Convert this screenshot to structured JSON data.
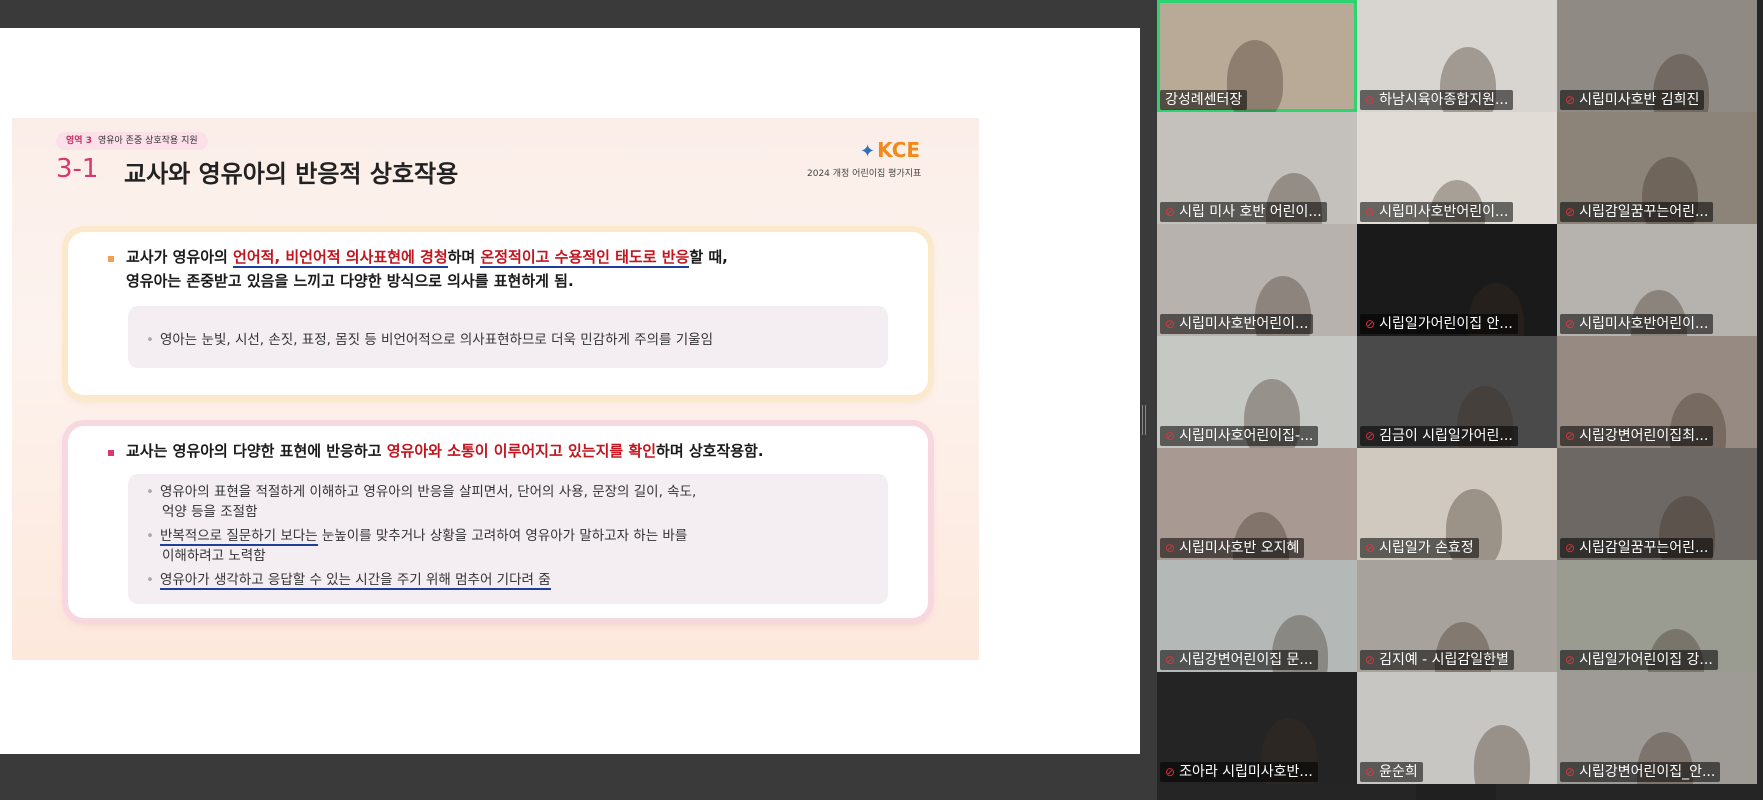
{
  "slide": {
    "tag_number": "영역 3",
    "tag_label": "영유아 존중 상호작용 지원",
    "section_number": "3-1",
    "section_title": "교사와 영유아의 반응적 상호작용",
    "logo_text": "KCE",
    "logo_sub": "2024 개정 어린이집 평가지표",
    "card1": {
      "line1_a": "교사가 영유아의 ",
      "line1_b": "언어적, 비언어적 의사표현에 경청",
      "line1_c": "하며 ",
      "line1_d": "온정적이고 수용적인 태도로 반응",
      "line1_e": "할 때,",
      "line2": "영유아는 존중받고 있음을 느끼고 다양한 방식으로 의사를 표현하게 됨.",
      "sub1": "영아는 눈빛, 시선, 손짓, 표정, 몸짓 등 비언어적으로 의사표현하므로 더욱 민감하게 주의를 기울임"
    },
    "card2": {
      "line1_a": "교사는 영유아의 다양한 표현에 반응하고 ",
      "line1_b": "영유아와 소통이 이루어지고 있는지를 확인",
      "line1_c": "하며 상호작용함.",
      "sub1": "영유아의 표현을 적절하게 이해하고  영유아의 반응을 살피면서, 단어의 사용, 문장의 길이, 속도,",
      "sub1b": "억양 등을 조절함",
      "sub2_a": "반복적으로 질문하기 보다는",
      "sub2_b": " 눈높이를 맞추거나 상황을 고려하여 영유아가 말하고자 하는 바를",
      "sub2c": "이해하려고 노력함",
      "sub3": "영유아가 생각하고 응답할 수 있는 시간을 주기 위해 멈추어 기다려 줌"
    }
  },
  "participants": [
    {
      "name": "강성례센터장",
      "muted": false
    },
    {
      "name": "하남시육아종합지원...",
      "muted": true
    },
    {
      "name": "시립미사호반 김희진",
      "muted": true
    },
    {
      "name": "시립 미사 호반 어린이...",
      "muted": true
    },
    {
      "name": "시립미사호반어린이...",
      "muted": true
    },
    {
      "name": "시립감일꿈꾸는어린...",
      "muted": true
    },
    {
      "name": "시립미사호반어린이...",
      "muted": true
    },
    {
      "name": "시립일가어린이집 안...",
      "muted": true
    },
    {
      "name": "시립미사호반어린이...",
      "muted": true
    },
    {
      "name": "시립미사호어린이집-...",
      "muted": true
    },
    {
      "name": "김금이 시립일가어린...",
      "muted": true
    },
    {
      "name": "시립강변어린이집최...",
      "muted": true
    },
    {
      "name": "시립미사호반 오지혜",
      "muted": true
    },
    {
      "name": "시립일가 손효정",
      "muted": true
    },
    {
      "name": "시립감일꿈꾸는어린...",
      "muted": true
    },
    {
      "name": "시립강변어린이집 문...",
      "muted": true
    },
    {
      "name": "김지예 - 시립감일한별",
      "muted": true
    },
    {
      "name": "시립일가어린이집 강...",
      "muted": true
    },
    {
      "name": "조아라 시립미사호반...",
      "muted": true
    },
    {
      "name": "윤순희",
      "muted": true
    },
    {
      "name": "시립강변어린이집_안...",
      "muted": true
    }
  ],
  "colors": {
    "active_speaker": "#2bd46e",
    "muted_mic": "#e8303a",
    "slide_accent": "#d8386e",
    "highlight_red": "#c4141e",
    "underline_blue": "#1e3f9a"
  }
}
